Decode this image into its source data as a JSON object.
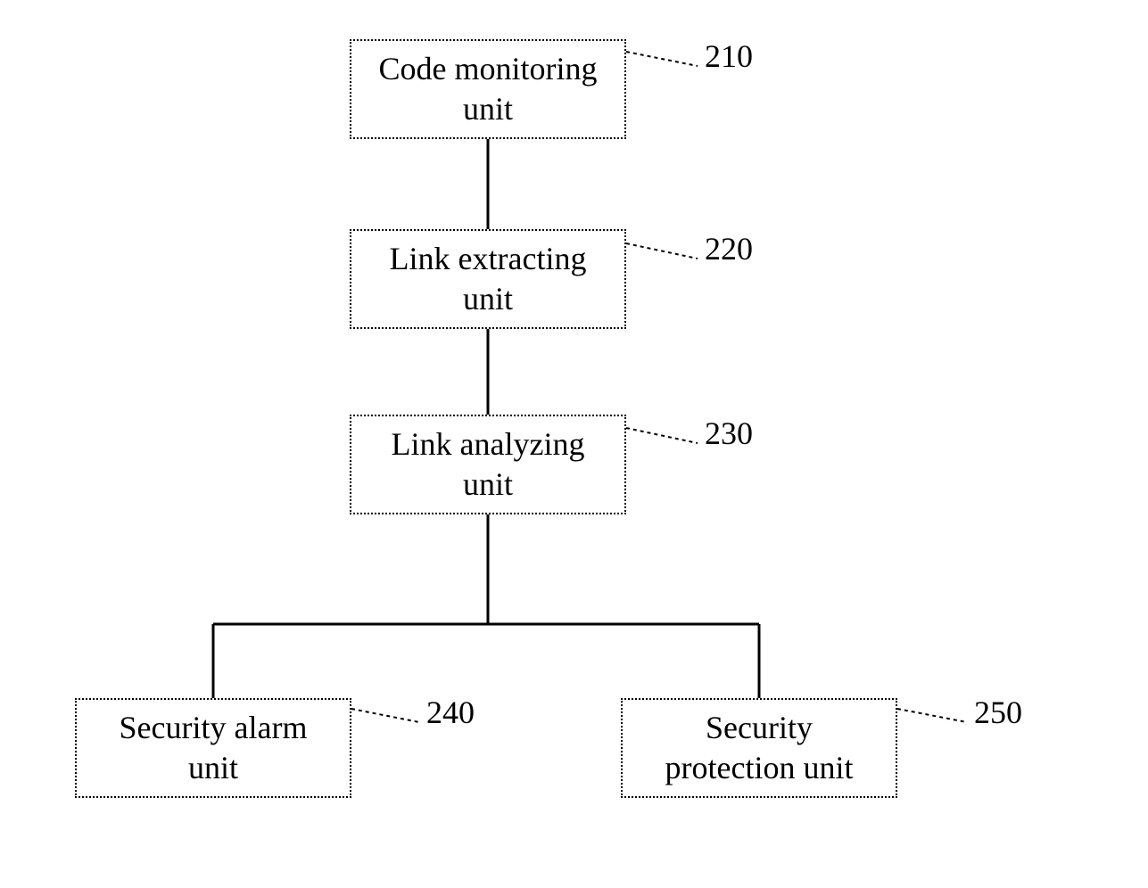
{
  "blocks": {
    "b1": {
      "text": "Code monitoring\nunit",
      "ref": "210"
    },
    "b2": {
      "text": "Link extracting\nunit",
      "ref": "220"
    },
    "b3": {
      "text": "Link analyzing\nunit",
      "ref": "230"
    },
    "b4": {
      "text": "Security alarm\nunit",
      "ref": "240"
    },
    "b5": {
      "text": "Security\nprotection unit",
      "ref": "250"
    }
  }
}
